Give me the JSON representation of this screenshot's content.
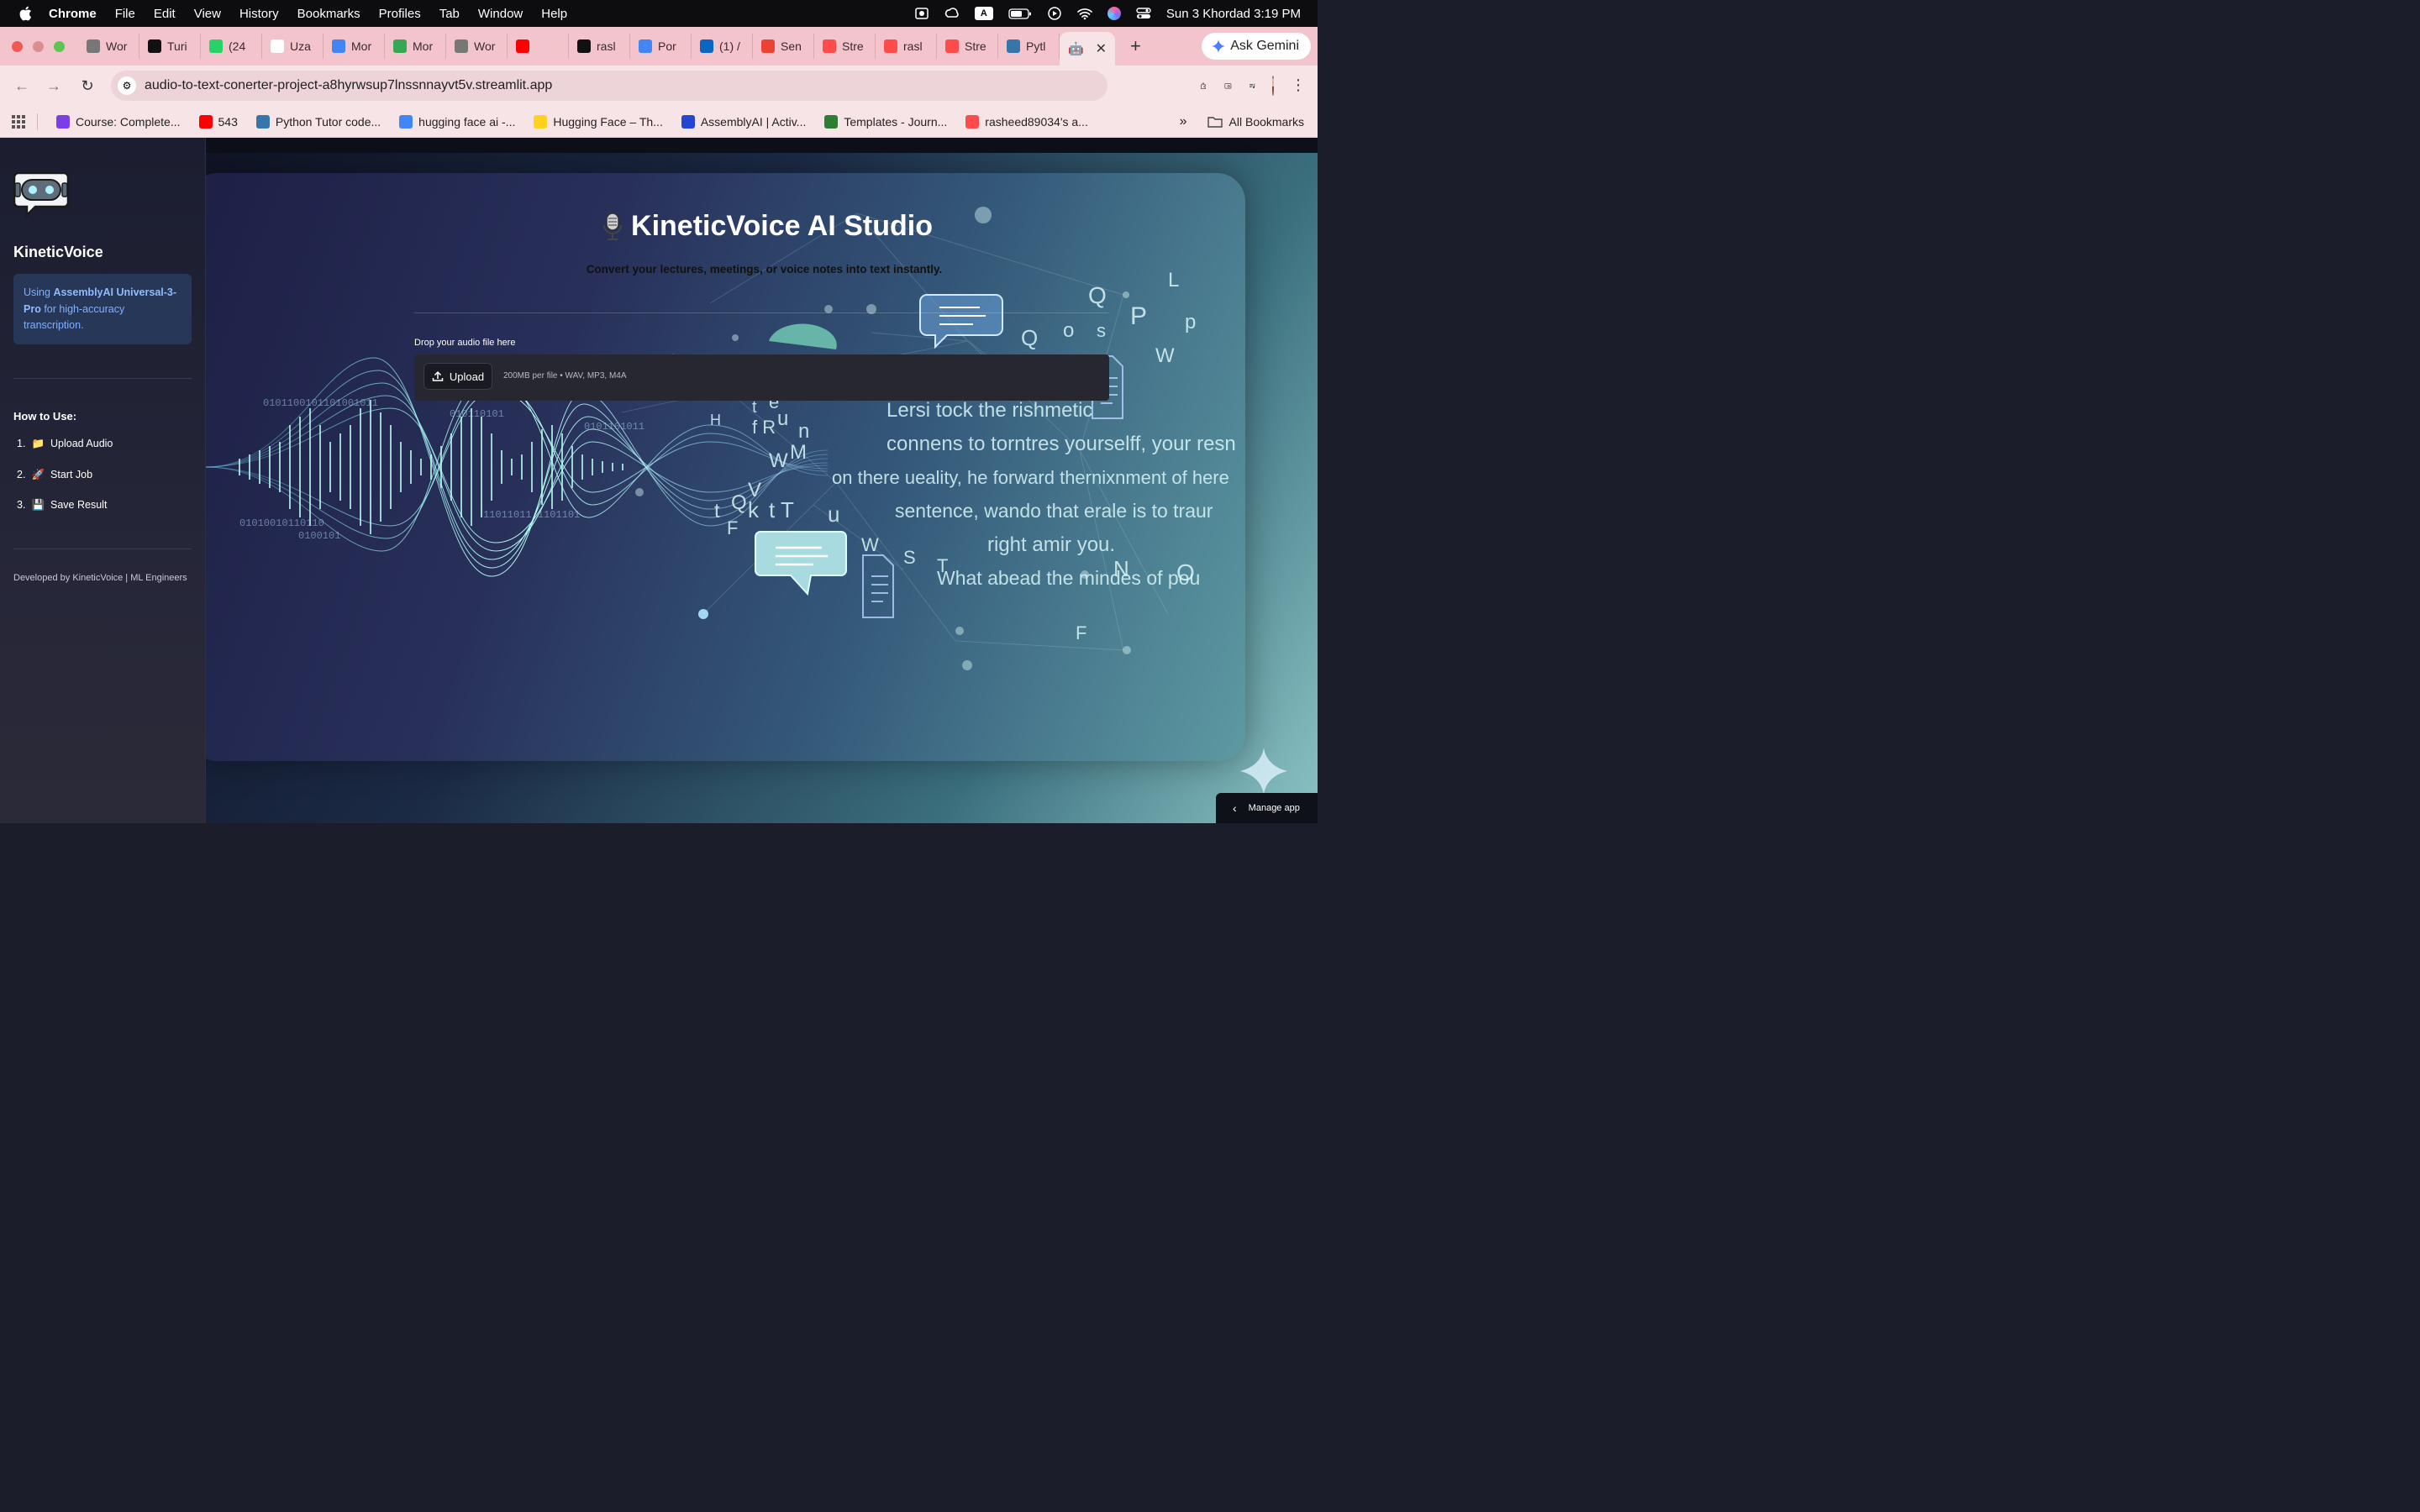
{
  "menubar": {
    "app": "Chrome",
    "items": [
      "File",
      "Edit",
      "View",
      "History",
      "Bookmarks",
      "Profiles",
      "Tab",
      "Window",
      "Help"
    ],
    "badge": "A",
    "datetime": "Sun 3 Khordad  3:19 PM"
  },
  "tabs": [
    {
      "label": "Wor",
      "color": "#777777"
    },
    {
      "label": "Turi",
      "color": "#111111"
    },
    {
      "label": "(24",
      "color": "#25D366"
    },
    {
      "label": "Uza",
      "color": "#ffffff"
    },
    {
      "label": "Mor",
      "color": "#4285F4"
    },
    {
      "label": "Mor",
      "color": "#34A853"
    },
    {
      "label": "Wor",
      "color": "#777777"
    },
    {
      "label": "",
      "color": "#FF0000"
    },
    {
      "label": "rasl",
      "color": "#111111"
    },
    {
      "label": "Por",
      "color": "#4285F4"
    },
    {
      "label": "(1) /",
      "color": "#0A66C2"
    },
    {
      "label": "Sen",
      "color": "#EA4335"
    },
    {
      "label": "Stre",
      "color": "#FF4B4B"
    },
    {
      "label": "rasl",
      "color": "#FF4B4B"
    },
    {
      "label": "Stre",
      "color": "#FF4B4B"
    },
    {
      "label": "Pytl",
      "color": "#3776AB"
    }
  ],
  "ask_gemini": "Ask Gemini",
  "address": {
    "url": "audio-to-text-conerter-project-a8hyrwsup7lnssnnayvt5v.streamlit.app"
  },
  "bookmarks": [
    {
      "label": "Course: Complete...",
      "color": "#7B3FE4"
    },
    {
      "label": "543",
      "color": "#FF0000"
    },
    {
      "label": "Python Tutor code...",
      "color": "#3776AB"
    },
    {
      "label": "hugging face ai -...",
      "color": "#4285F4"
    },
    {
      "label": "Hugging Face – Th...",
      "color": "#FFD21E"
    },
    {
      "label": "AssemblyAI | Activ...",
      "color": "#2545D3"
    },
    {
      "label": "Templates - Journ...",
      "color": "#2E7D32"
    },
    {
      "label": "rasheed89034's a...",
      "color": "#FF4B4B"
    }
  ],
  "all_bookmarks": "All Bookmarks",
  "sidebar": {
    "title": "KineticVoice",
    "info_prefix": "Using ",
    "info_bold": "AssemblyAI Universal-3-Pro",
    "info_suffix": " for high-accuracy transcription.",
    "howto": "How to Use:",
    "steps": [
      {
        "num": "1.",
        "icon": "📁",
        "label": "Upload Audio"
      },
      {
        "num": "2.",
        "icon": "🚀",
        "label": "Start Job"
      },
      {
        "num": "3.",
        "icon": "💾",
        "label": "Save Result"
      }
    ],
    "credit": "Developed by KineticVoice | ML Engineers"
  },
  "main": {
    "title": "KineticVoice AI Studio",
    "subtitle": "Convert your lectures, meetings, or voice notes into text instantly.",
    "drop_label": "Drop your audio file here",
    "upload_label": "Upload",
    "limits": "200MB per file • WAV, MP3, M4A"
  },
  "manage_app": "Manage app",
  "colors": {
    "accent": "#FF4B4B",
    "info_bg": "#263758",
    "info_text": "#7fb0ff",
    "tabstrip": "#f3c4cc"
  }
}
